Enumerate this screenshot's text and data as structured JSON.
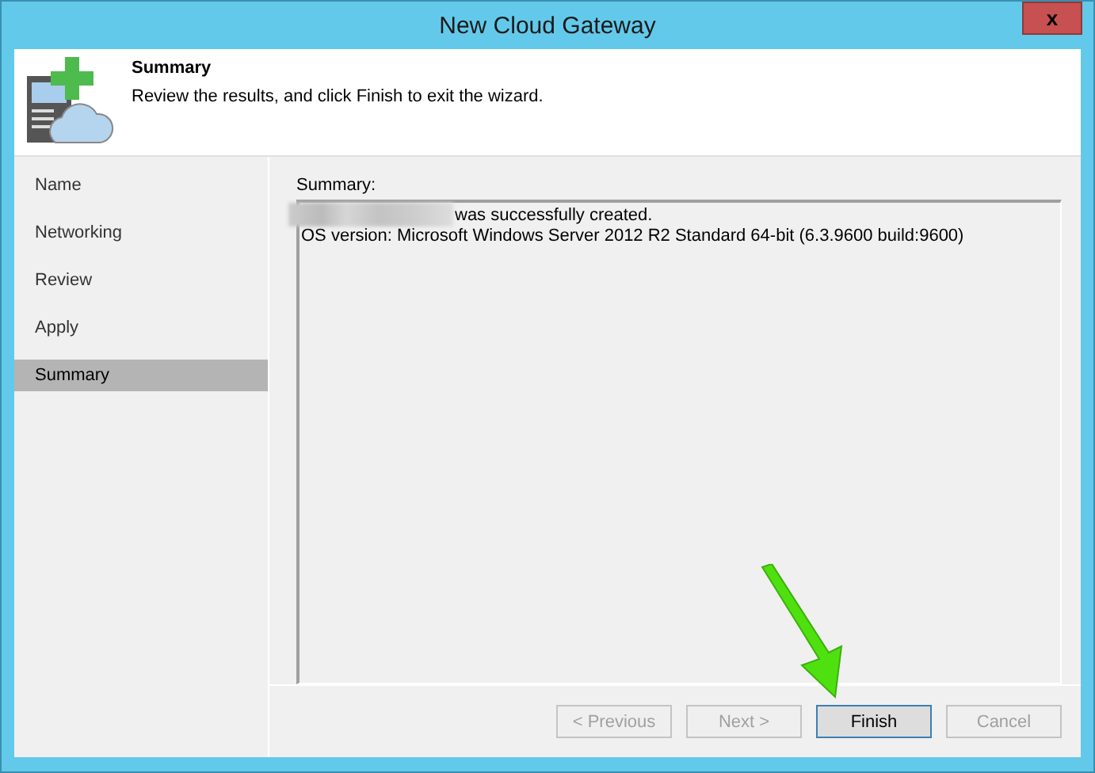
{
  "window": {
    "title": "New Cloud Gateway",
    "close": "x"
  },
  "header": {
    "title": "Summary",
    "description": "Review the results, and click Finish to exit the wizard."
  },
  "steps": [
    {
      "label": "Name",
      "selected": false
    },
    {
      "label": "Networking",
      "selected": false
    },
    {
      "label": "Review",
      "selected": false
    },
    {
      "label": "Apply",
      "selected": false
    },
    {
      "label": "Summary",
      "selected": true
    }
  ],
  "summary": {
    "label": "Summary:",
    "lines": [
      {
        "text": "was successfully created.",
        "redacted_prefix": true
      },
      {
        "text": "OS version: Microsoft Windows Server 2012 R2 Standard 64-bit (6.3.9600 build:9600)",
        "redacted_prefix": false
      }
    ]
  },
  "buttons": [
    {
      "label": "< Previous",
      "disabled": true,
      "default": false
    },
    {
      "label": "Next >",
      "disabled": true,
      "default": false
    },
    {
      "label": "Finish",
      "disabled": false,
      "default": true
    },
    {
      "label": "Cancel",
      "disabled": true,
      "default": false
    }
  ]
}
